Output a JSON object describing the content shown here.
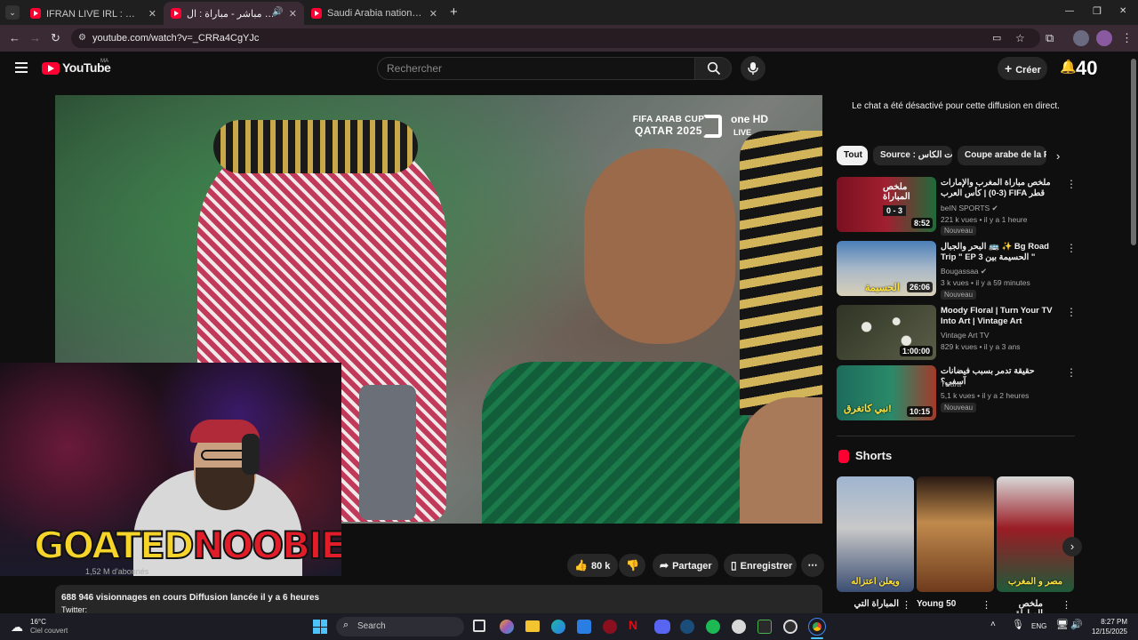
{
  "browser": {
    "tabs": [
      {
        "title": "IFRAN LIVE IRL : سويسرا المغرب",
        "active": false
      },
      {
        "title": "كأس العرب مباشر - مباراة : ال",
        "active": true
      },
      {
        "title": "Saudi Arabia national Day",
        "active": false
      }
    ],
    "new_tab": "+",
    "url": "youtube.com/watch?v=_CRRa4CgYJc",
    "window_controls": {
      "minimize": "—",
      "restore": "❐",
      "close": "✕"
    }
  },
  "header": {
    "logo_text": "YouTube",
    "country": "MA",
    "search_placeholder": "Rechercher",
    "create_label": "Créer",
    "notification_count": "40"
  },
  "video": {
    "overlay_line1": "FIFA ARAB CUP",
    "overlay_line2": "QATAR 2025",
    "channel_brand": "one HD",
    "live_label": "LIVE",
    "subscribers": "1,52 M d'abonnés",
    "streamer_name_part1": "GOATED",
    "streamer_name_part2": "NOOBIE",
    "likes": "80 k",
    "share_label": "Partager",
    "save_label": "Enregistrer",
    "views_line": "688 946 visionnages en cours  Diffusion lancée il y a 6 heures",
    "twitter_label": "Twitter:"
  },
  "sidebar": {
    "chat_disabled": "Le chat a été désactivé pour cette diffusion en direct.",
    "chips": [
      "Tout",
      "Source : قنوات الكاس",
      "Coupe arabe de la FIFA"
    ],
    "videos": [
      {
        "title": "ملخص مباراة المغرب والإمارات (3-0) | كأس العرب FIFA قطر 2025™ - الدور ...",
        "channel": "beIN SPORTS",
        "verified": true,
        "meta": "221 k vues • il y a 1 heure",
        "badge": "Nouveau",
        "duration": "8:52",
        "thumb_text": "ملخص المباراة",
        "score": "0 - 3",
        "colors": [
          "#7a1020",
          "#1f6b3a"
        ]
      },
      {
        "title": "البحر والجبال 🚌 ✨ Bg Road Trip \" EP 3 الحسيمة بين \"",
        "channel": "Bougassaa",
        "verified": true,
        "meta": "3 k vues • il y a 59 minutes",
        "badge": "Nouveau",
        "duration": "26:06",
        "thumb_text": "الحسيمة",
        "colors": [
          "#4a7fb8",
          "#d8d0b8"
        ]
      },
      {
        "title": "Moody Floral | Turn Your TV Into Art | Vintage Art Slideshow Fo...",
        "channel": "Vintage Art TV",
        "verified": false,
        "meta": "829 k vues • il y a 3 ans",
        "badge": "",
        "duration": "1:00:00",
        "thumb_text": "",
        "colors": [
          "#3a3f2c",
          "#6b6e55"
        ]
      },
      {
        "title": "حقيقة تدمر بسبب فيضانات آسفي؟",
        "channel": "Twara",
        "verified": false,
        "meta": "5,1 k vues • il y a 2 heures",
        "badge": "Nouveau",
        "duration": "10:15",
        "thumb_text": "نبي كاتغرق!",
        "colors": [
          "#1d6b5b",
          "#a33a2a"
        ]
      }
    ],
    "shorts_label": "Shorts",
    "shorts": [
      {
        "caption": "ويعلن اعتزاله",
        "title": "المباراة التي",
        "colors": [
          "#9fb5d0",
          "#3b4e73"
        ]
      },
      {
        "caption": "",
        "title": "Young 50",
        "colors": [
          "#6e3b1d",
          "#c08a4c"
        ]
      },
      {
        "caption": "مصر و المغرب",
        "title": "ملخص المباراة",
        "colors": [
          "#9a1c24",
          "#1f5a3a"
        ]
      }
    ]
  },
  "taskbar": {
    "weather_temp": "16°C",
    "weather_desc": "Ciel couvert",
    "search_label": "Search",
    "language": "ENG",
    "time": "8:27 PM",
    "date": "12/15/2025"
  }
}
